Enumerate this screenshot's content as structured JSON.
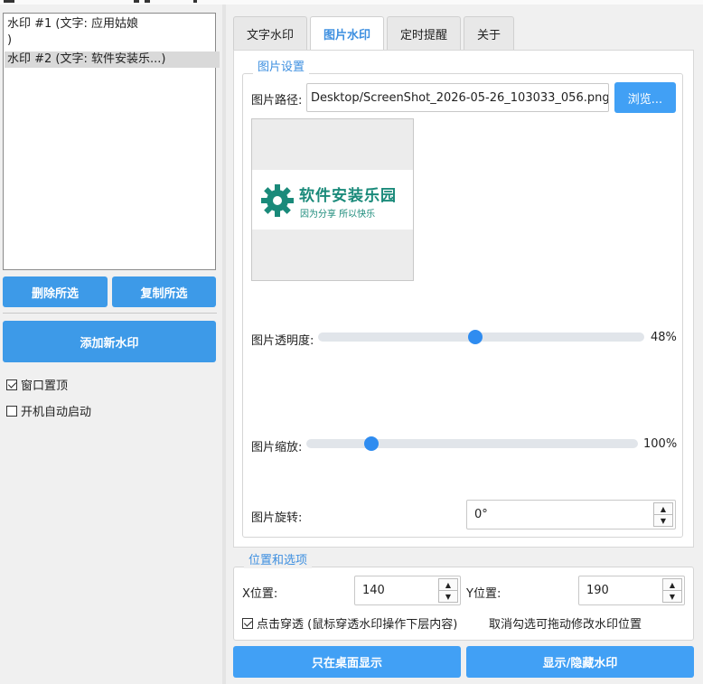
{
  "watermark_list": {
    "items": [
      "水印 #1 (文字: 应用姑娘\n)",
      "水印 #2 (文字: 软件安装乐...)"
    ]
  },
  "left_actions": {
    "delete_label": "删除所选",
    "copy_label": "复制所选",
    "add_label": "添加新水印"
  },
  "options": {
    "always_on_top": {
      "label": "窗口置顶",
      "checked": true
    },
    "autostart": {
      "label": "开机自动启动",
      "checked": false
    }
  },
  "tabs": [
    "文字水印",
    "图片水印",
    "定时提醒",
    "关于"
  ],
  "active_tab": "图片水印",
  "image_settings": {
    "group_title": "图片设置",
    "path_label": "图片路径:",
    "path_value": "Desktop/ScreenShot_2026-05-26_103033_056.png",
    "browse_label": "浏览...",
    "preview": {
      "logo_title": "软件安装乐园",
      "logo_slogan": "因为分享 所以快乐"
    },
    "opacity": {
      "label": "图片透明度:",
      "value": 48,
      "display": "48%"
    },
    "scale": {
      "label": "图片缩放:",
      "value": 100,
      "display": "100%",
      "min": 10,
      "max": 500
    },
    "rotation": {
      "label": "图片旋转:",
      "value": "0°"
    }
  },
  "position": {
    "group_title": "位置和选项",
    "x_label": "X位置:",
    "x_value": "140",
    "y_label": "Y位置:",
    "y_value": "190",
    "click_through": {
      "label": "点击穿透 (鼠标穿透水印操作下层内容)",
      "checked": true
    },
    "hint": "取消勾选可拖动修改水印位置"
  },
  "bottom_actions": {
    "desktop_only_label": "只在桌面显示",
    "toggle_label": "显示/隐藏水印"
  },
  "colors": {
    "accent": "#3d9ae8",
    "thumb": "#2f8cf0",
    "logo_green": "#1a8a7a"
  }
}
